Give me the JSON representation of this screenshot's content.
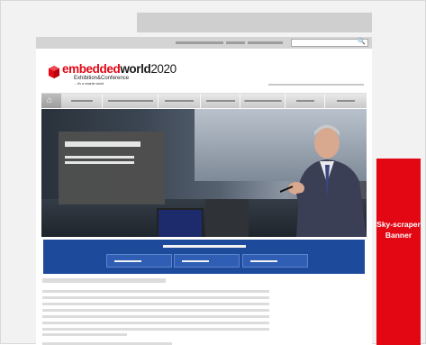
{
  "page": {
    "logo": {
      "brand_red": "embedded",
      "brand_dark": "world",
      "brand_year": "2020",
      "subtitle": "Exhibition&Conference",
      "tagline": "... it's a smarter world"
    },
    "search": {
      "icon": "search-icon"
    },
    "nav": {
      "home_icon": "home-icon"
    },
    "ads": {
      "skyscraper_label": "Sky-scraper Banner"
    }
  },
  "colors": {
    "brand_red": "#e30613",
    "banner_blue": "#1e4a9b",
    "skyscraper_red": "#e30613",
    "placeholder_grey": "#dcdcdc"
  }
}
